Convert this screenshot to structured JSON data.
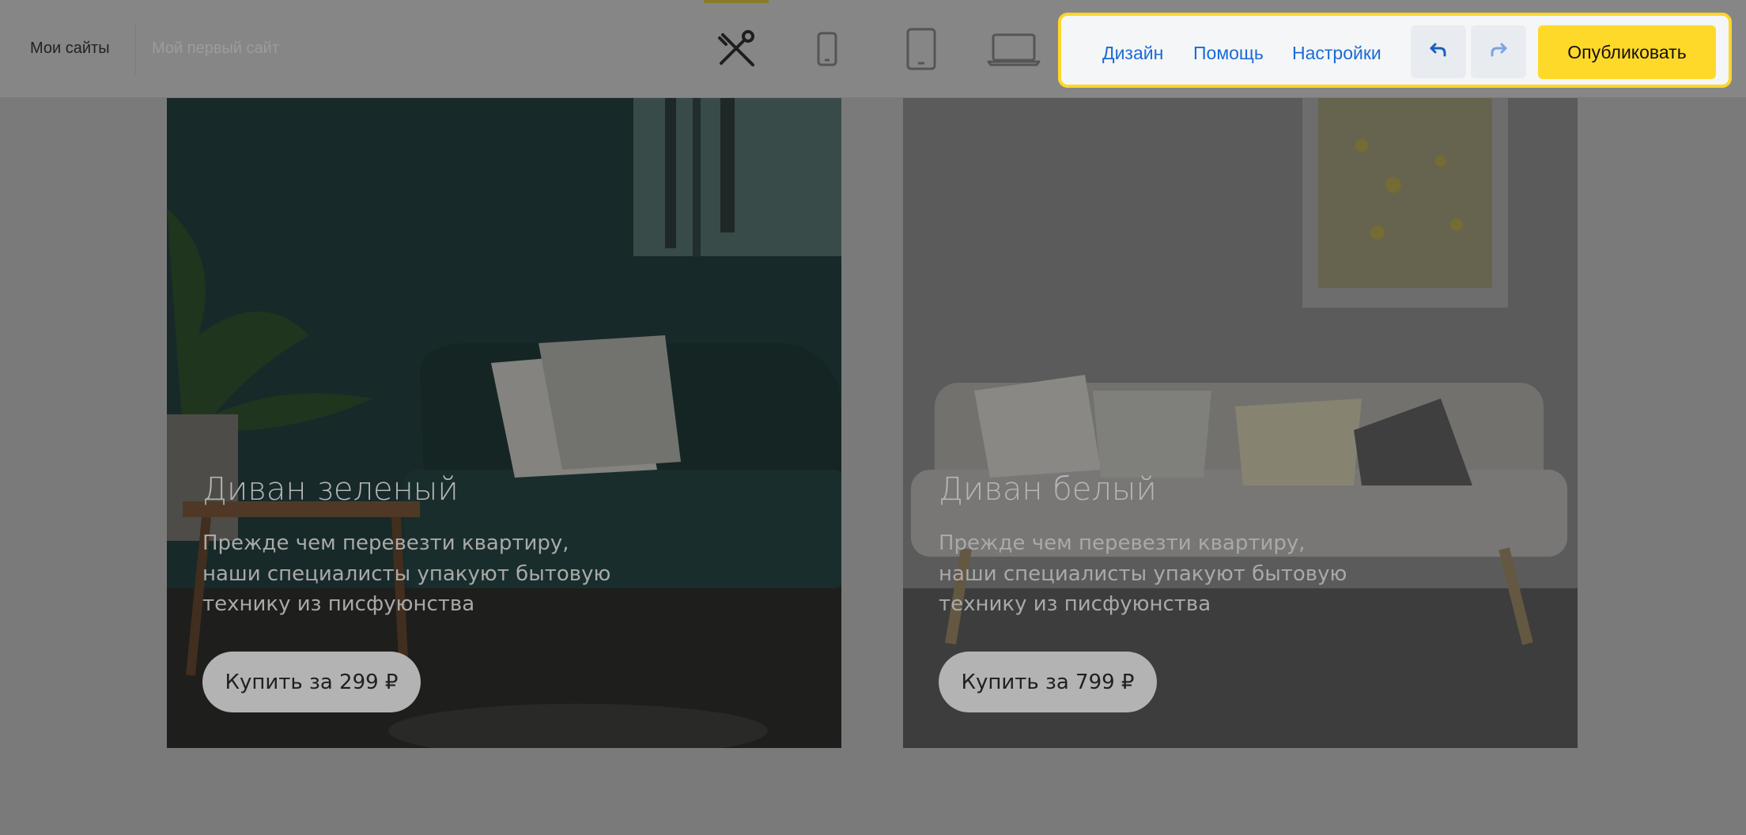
{
  "header": {
    "breadcrumb_main": "Мои сайты",
    "breadcrumb_site": "Мой первый сайт",
    "devices": [
      "tools-icon",
      "phone-icon",
      "tablet-icon",
      "laptop-icon"
    ],
    "active_device": "tools-icon"
  },
  "toolbar": {
    "design_label": "Дизайн",
    "help_label": "Помощь",
    "settings_label": "Настройки",
    "undo_icon": "undo-icon",
    "redo_icon": "redo-icon",
    "publish_label": "Опубликовать",
    "accent_color": "#ffd929",
    "link_color": "#1a6bd6"
  },
  "cards": [
    {
      "title": "Диван зеленый",
      "description_lines": [
        "Прежде чем перевезти квартиру,",
        "наши специалисты упакуют бытовую",
        "технику из писфуюнства"
      ],
      "button": "Купить за 299 ₽"
    },
    {
      "title": "Диван белый",
      "description_lines": [
        "Прежде чем перевезти квартиру,",
        "наши специалисты упакуют бытовую",
        "технику из писфуюнства"
      ],
      "button": "Купить за 799 ₽"
    }
  ],
  "overlay": "dimmed"
}
